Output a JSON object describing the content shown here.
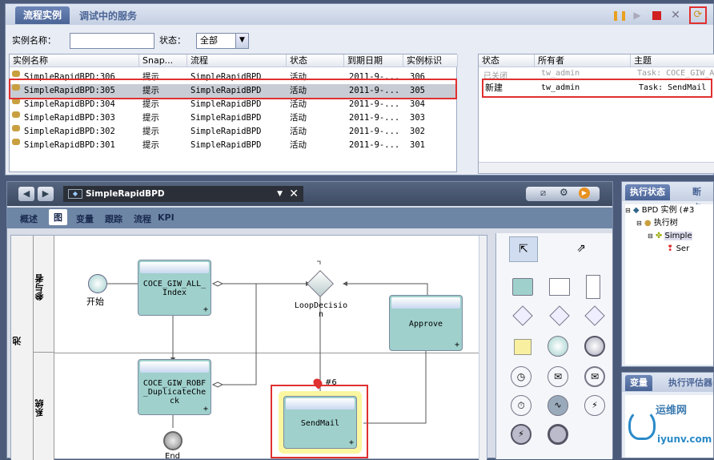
{
  "top_tabs": [
    "流程实例",
    "调试中的服务"
  ],
  "filter": {
    "name_label": "实例名称：",
    "name_value": "",
    "status_label": "状态：",
    "status_value": "全部"
  },
  "instance_table": {
    "headers": [
      "实例名称",
      "Snap...",
      "流程",
      "状态",
      "到期日期",
      "实例标识"
    ],
    "rows": [
      [
        "SimpleRapidBPD:306",
        "提示",
        "SimpleRapidBPD",
        "活动",
        "2011-9-...",
        "306"
      ],
      [
        "SimpleRapidBPD:305",
        "提示",
        "SimpleRapidBPD",
        "活动",
        "2011-9-...",
        "305"
      ],
      [
        "SimpleRapidBPD:304",
        "提示",
        "SimpleRapidBPD",
        "活动",
        "2011-9-...",
        "304"
      ],
      [
        "SimpleRapidBPD:303",
        "提示",
        "SimpleRapidBPD",
        "活动",
        "2011-9-...",
        "303"
      ],
      [
        "SimpleRapidBPD:302",
        "提示",
        "SimpleRapidBPD",
        "活动",
        "2011-9-...",
        "302"
      ],
      [
        "SimpleRapidBPD:301",
        "提示",
        "SimpleRapidBPD",
        "活动",
        "2011-9-...",
        "301"
      ]
    ]
  },
  "task_table": {
    "headers": [
      "状态",
      "所有者",
      "主题"
    ],
    "rows": [
      [
        "已关闭",
        "tw_admin",
        "Task: COCE_GIW_A"
      ],
      [
        "新建",
        "tw_admin",
        "Task: SendMail"
      ]
    ]
  },
  "bpd": {
    "title": "SimpleRapidBPD",
    "view_tabs": [
      "概述",
      "图",
      "变量",
      "跟踪",
      "流程",
      "KPI"
    ],
    "pool_label": "池",
    "lanes": [
      "参与者",
      "系统"
    ],
    "start_label": "开始",
    "tasks": {
      "index": "COCE_GIW_ALL_Index",
      "dup": "COCE_GIW_ROBF_DuplicateCheck",
      "approve": "Approve",
      "sendmail": "SendMail"
    },
    "gateway_label": "LoopDecision",
    "token_label": "#6",
    "end_label": "End"
  },
  "exec_panel": {
    "tabs": [
      "执行状态",
      "断点"
    ],
    "tree": [
      "BPD 实例 (#3",
      "执行树",
      "Simple",
      "Ser"
    ]
  },
  "var_panel": {
    "tabs": [
      "变量",
      "执行评估器"
    ]
  },
  "watermark": {
    "line1": "运维网",
    "line2": "iyunv.com"
  }
}
